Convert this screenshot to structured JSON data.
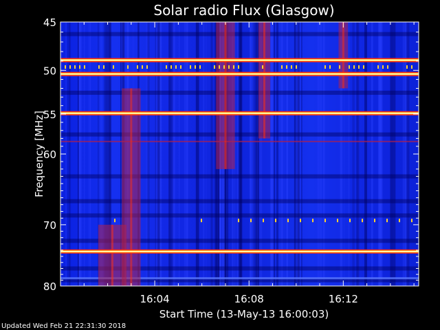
{
  "chart_data": {
    "type": "heatmap",
    "title": "Solar radio Flux (Glasgow)",
    "xlabel": "Start Time (13-May-13 16:00:03)",
    "ylabel": "Frequency [MHz]",
    "x_ticks": [
      "16:04",
      "16:08",
      "16:12"
    ],
    "y_ticks": [
      "45",
      "50",
      "55",
      "60",
      "70",
      "80"
    ],
    "x_range_minutes": [
      0,
      15.2
    ],
    "y_range_mhz": [
      45,
      80
    ],
    "y_scale": "log",
    "colormap": [
      "#000060",
      "#0018d8",
      "#2a40ff",
      "#b0204a",
      "#ff3010",
      "#ffd030",
      "#ffffd0"
    ],
    "bright_bands_mhz": [
      48.9,
      50.4,
      54.9,
      74.2
    ],
    "bursts": [
      {
        "start_min": 1.6,
        "end_min": 2.8,
        "freq_low": 70,
        "freq_high": 80
      },
      {
        "start_min": 2.6,
        "end_min": 3.4,
        "freq_low": 52,
        "freq_high": 80
      },
      {
        "start_min": 6.6,
        "end_min": 7.4,
        "freq_low": 45,
        "freq_high": 62
      },
      {
        "start_min": 8.4,
        "end_min": 8.9,
        "freq_low": 45,
        "freq_high": 58
      },
      {
        "start_min": 11.8,
        "end_min": 12.2,
        "freq_low": 45,
        "freq_high": 52
      }
    ],
    "grid": false,
    "legend": "none"
  },
  "footer": {
    "updated": "Updated Wed Feb 21 22:31:30 2018"
  }
}
